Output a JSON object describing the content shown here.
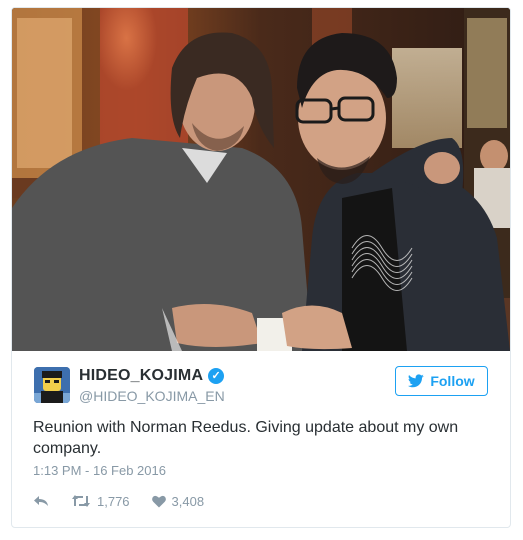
{
  "tweet": {
    "display_name": "HIDEO_KOJIMA",
    "handle": "@HIDEO_KOJIMA_EN",
    "verified": true,
    "follow_label": "Follow",
    "text": "Reunion with Norman Reedus. Giving update about my own company.",
    "timestamp": "1:13 PM - 16 Feb 2016",
    "retweet_count": "1,776",
    "like_count": "3,408"
  },
  "colors": {
    "accent": "#1da1f2",
    "text": "#292f33",
    "muted": "#8899a6",
    "border": "#e1e8ed"
  },
  "icons": {
    "reply": "reply-icon",
    "retweet": "retweet-icon",
    "like": "heart-icon",
    "verified": "verified-badge-icon",
    "twitter_bird": "twitter-bird-icon"
  }
}
